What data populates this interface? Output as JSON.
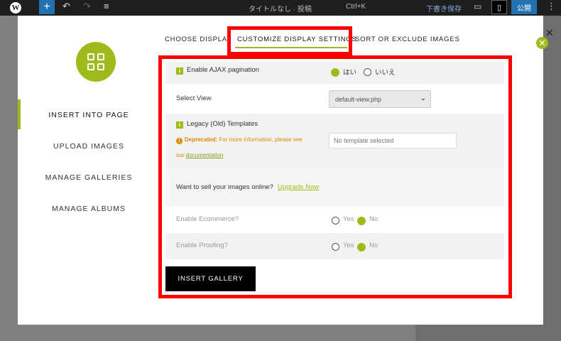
{
  "wp_editor": {
    "logo_icon": "wordpress-logo-icon",
    "add_block_label": "+",
    "undo_icon": "undo-icon",
    "redo_icon": "redo-icon",
    "list_view_icon": "list-view-icon",
    "doc_title": "タイトルなし · 投稿",
    "shortcut": "Ctrl+K",
    "save_draft": "下書き保存",
    "preview_icon": "desktop-preview-icon",
    "settings_icon": "sidebar-settings-icon",
    "publish": "公開",
    "more_icon": "more-vertical-icon"
  },
  "modal": {
    "close_icon": "close-circle-icon",
    "close_glyph": "✕",
    "logo_icon": "gallery-grid-logo-icon",
    "side_nav": [
      {
        "label": "INSERT INTO PAGE",
        "active": true
      },
      {
        "label": "UPLOAD IMAGES",
        "active": false
      },
      {
        "label": "MANAGE GALLERIES",
        "active": false
      },
      {
        "label": "MANAGE ALBUMS",
        "active": false
      }
    ],
    "tabs": [
      {
        "label": "CHOOSE DISPLAY",
        "active": false
      },
      {
        "label": "CUSTOMIZE DISPLAY SETTINGS",
        "active": true
      },
      {
        "label": "SORT OR EXCLUDE IMAGES",
        "active": false
      }
    ],
    "settings": {
      "ajax": {
        "label": "Enable AJAX pagination",
        "info_icon": "info-icon",
        "options": [
          "はい",
          "いいえ"
        ],
        "selected": "はい"
      },
      "view": {
        "label": "Select View",
        "value": "default-view.php",
        "chevron_icon": "chevron-down-icon"
      },
      "legacy": {
        "label": "Legacy (Old) Templates",
        "info_icon": "info-icon",
        "warning_icon": "warning-icon",
        "deprecated": "Deprecated:",
        "warning_text": "For more information, please see",
        "warning_prefix": "our",
        "doc_link": "documentation",
        "placeholder": "No template selected"
      },
      "sell": {
        "text": "Want to sell your images online?",
        "link": "Upgrade Now"
      },
      "ecommerce": {
        "label": "Enable Ecommerce?",
        "options": [
          "Yes",
          "No"
        ],
        "selected": "No"
      },
      "proofing": {
        "label": "Enable Proofing?",
        "options": [
          "Yes",
          "No"
        ],
        "selected": "No"
      }
    },
    "insert_button": "INSERT GALLERY"
  },
  "colors": {
    "accent": "#9fbb1b",
    "highlight": "#ff0000",
    "warning": "#e08a00"
  }
}
